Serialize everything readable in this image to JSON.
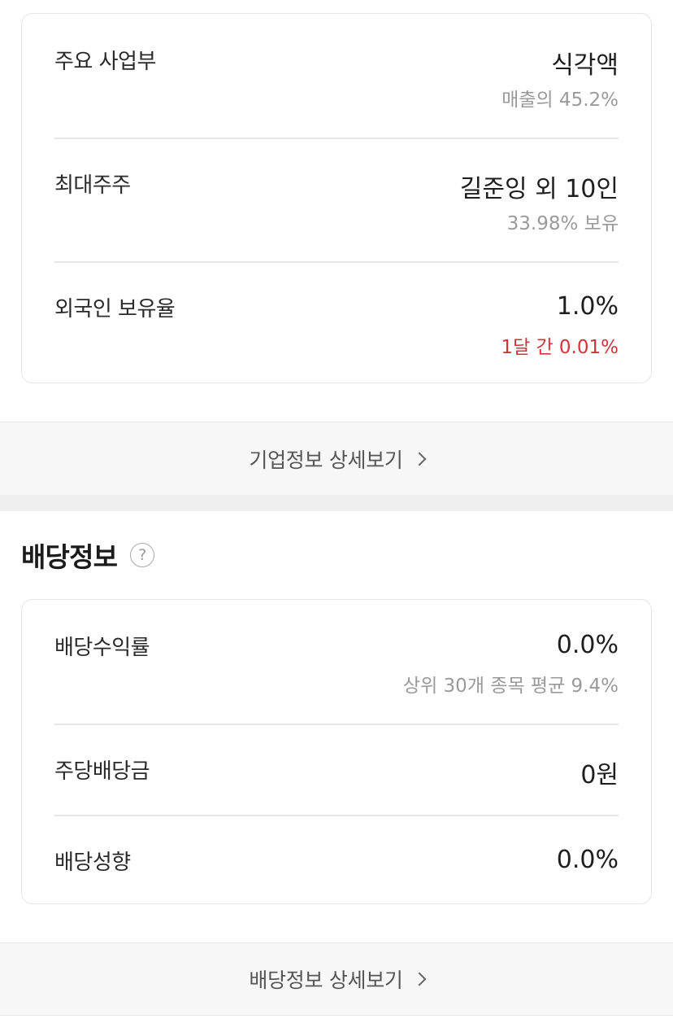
{
  "company_info": {
    "rows": [
      {
        "label": "주요 사업부",
        "value": "식각액",
        "sub": "매출의 45.2%"
      },
      {
        "label": "최대주주",
        "value": "길준잉 외 10인",
        "sub": "33.98% 보유"
      },
      {
        "label": "외국인 보유율",
        "value": "1.0%",
        "sub": "1달 간 0.01%"
      }
    ],
    "more_label": "기업정보 상세보기",
    "sub_accent_color": "#d3343a"
  },
  "dividend": {
    "title": "배당정보",
    "help_icon": "?",
    "rows": [
      {
        "label": "배당수익률",
        "value": "0.0%",
        "sub": "상위 30개 종목 평균 9.4%"
      },
      {
        "label": "주당배당금",
        "value": "0원"
      },
      {
        "label": "배당성향",
        "value": "0.0%"
      }
    ],
    "more_label": "배당정보 상세보기"
  }
}
